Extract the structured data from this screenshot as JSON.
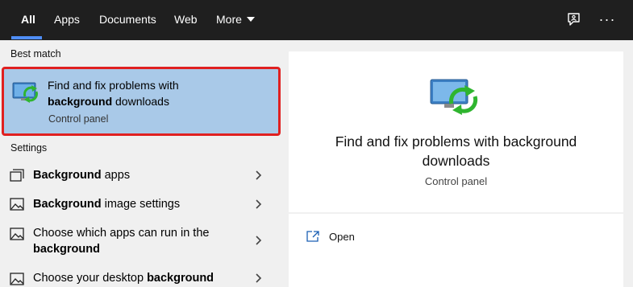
{
  "tabs": [
    {
      "label": "All",
      "active": true
    },
    {
      "label": "Apps"
    },
    {
      "label": "Documents"
    },
    {
      "label": "Web"
    },
    {
      "label": "More"
    }
  ],
  "top_icons": [
    "feedback-icon",
    "more-options-icon"
  ],
  "best_match": {
    "header": "Best match",
    "title_part1": "Find and fix problems with",
    "title_bold": "background",
    "title_part2": " downloads",
    "subtitle": "Control panel",
    "icon": "troubleshoot-monitor-icon"
  },
  "settings": {
    "header": "Settings",
    "items": [
      {
        "bold": "Background",
        "rest": " apps",
        "icon": "background-apps-icon"
      },
      {
        "bold": "Background",
        "rest": " image settings",
        "icon": "image-icon"
      },
      {
        "pre": "Choose which apps can run in the ",
        "bold": "background",
        "icon": "image-icon"
      },
      {
        "pre": "Choose your desktop ",
        "bold": "background",
        "icon": "image-icon"
      }
    ]
  },
  "preview": {
    "title": "Find and fix problems with background downloads",
    "subtitle": "Control panel",
    "actions": [
      {
        "label": "Open",
        "icon": "open-icon"
      }
    ]
  },
  "colors": {
    "topbar": "#1f1f1f",
    "accent": "#4f8ef7",
    "selected": "#a9c9e8",
    "highlight_border": "#e02020"
  }
}
